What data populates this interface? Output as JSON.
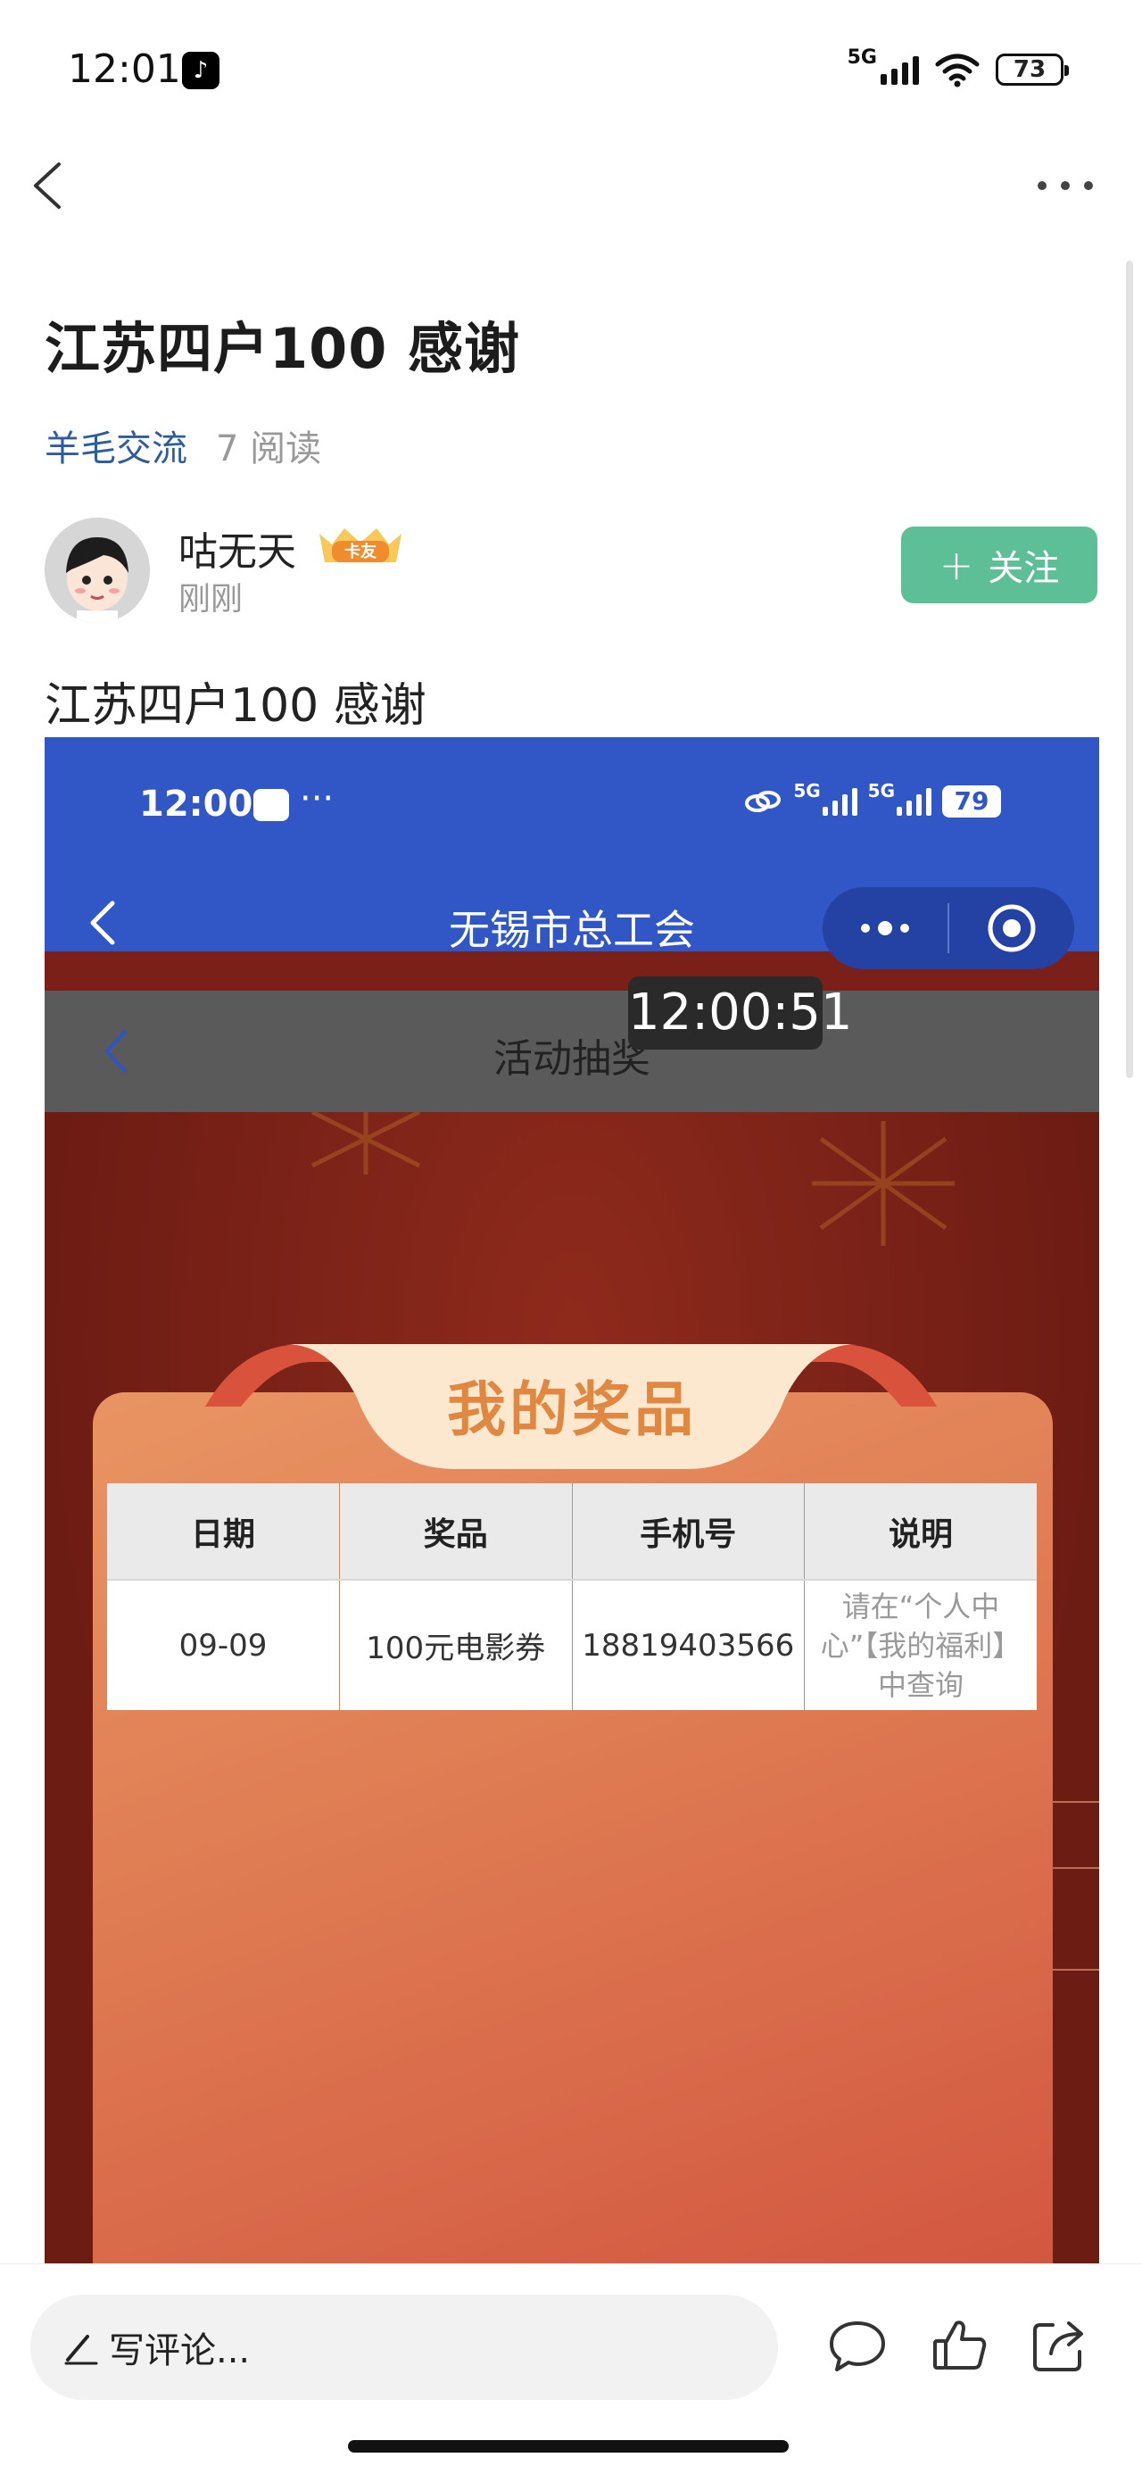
{
  "status_bar": {
    "time": "12:01",
    "network": "5G",
    "battery": "73"
  },
  "post": {
    "title": "江苏四户100 感谢",
    "category": "羊毛交流",
    "reads": "7 阅读",
    "author": {
      "name": "咕无天",
      "badge": "卡友",
      "time": "刚刚"
    },
    "follow_label": "关注",
    "body": "江苏四户100 感谢"
  },
  "embedded_screenshot": {
    "status_time": "12:00",
    "status_dots": "···",
    "network": "5G",
    "battery": "79",
    "nav_title": "无锡市总工会",
    "sub_title": "活动抽奖",
    "timer": "12:00:51",
    "prize_heading": "我的奖品",
    "table": {
      "headers": [
        "日期",
        "奖品",
        "手机号",
        "说明"
      ],
      "rows": [
        [
          "09-09",
          "100元电影券",
          "18819403566",
          "请在“个人中心”【我的福利】中查询"
        ]
      ]
    }
  },
  "bottom_bar": {
    "comment_placeholder": "写评论..."
  }
}
